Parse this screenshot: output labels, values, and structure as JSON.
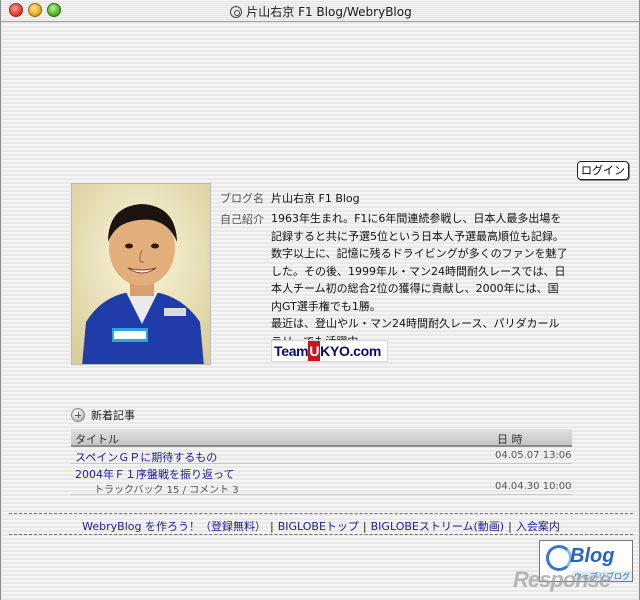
{
  "window": {
    "title": "片山右京 F1 Blog/WebryBlog"
  },
  "login": {
    "label": "ログイン"
  },
  "profile": {
    "blog_name_label": "ブログ名",
    "blog_name": "片山右京 F1 Blog",
    "intro_label": "自己紹介",
    "bio_lines": [
      "1963年生まれ。F1に6年間連続参戦し、日本人最多出場を",
      "記録すると共に予選5位という日本人予選最高順位も記録。",
      "数字以上に、記憶に残るドライビングが多くのファンを魅了",
      "した。その後、1999年ル・マン24時間耐久レースでは、日",
      "本人チーム初の総合2位の獲得に貢献し、2000年には、国",
      "内GT選手権でも1勝。",
      "最近は、登山やル・マン24時間耐久レース、パリダカール",
      "ラリーでも活躍中。"
    ],
    "team_logo": {
      "before": "Team",
      "mark": "U",
      "after": "KYO.com"
    }
  },
  "news": {
    "heading": "新着記事",
    "col_title": "タイトル",
    "col_date": "日 時",
    "rows": [
      {
        "title": "スペインＧＰに期待するもの",
        "date": "04.05.07 13:06"
      },
      {
        "title": "2004年Ｆ１序盤戦を振り返って",
        "sub": "トラックバック 15 / コメント 3",
        "date": "04.04.30 10:00"
      }
    ]
  },
  "footer": {
    "create_link": "WebryBlog を作ろう！（登録無料）",
    "sep": "|",
    "top_link": "BIGLOBEトップ",
    "stream_link": "BIGLOBEストリーム(動画)",
    "guide_link": "入会案内"
  },
  "badge": {
    "word": "Blog",
    "sub": "ウェブリブログ"
  },
  "watermark": {
    "text": "Response"
  },
  "colors": {
    "link": "#1c1c8c",
    "suit_blue": "#1f3ca8",
    "team_red": "#c8141e"
  }
}
